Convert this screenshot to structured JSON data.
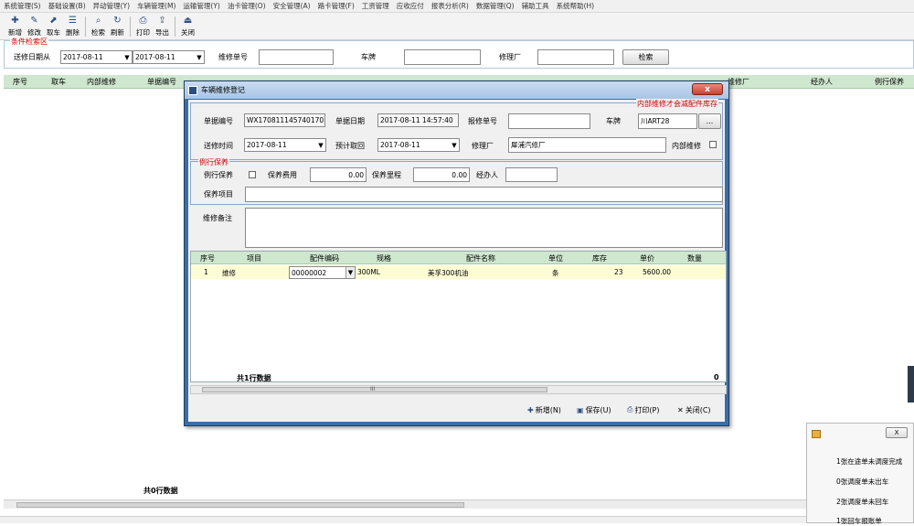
{
  "menu": [
    "系统管理(S)",
    "基础设置(B)",
    "异动管理(Y)",
    "车辆管理(M)",
    "运输管理(Y)",
    "油卡管理(O)",
    "安全管理(A)",
    "路卡管理(F)",
    "工资管理",
    "应收应付",
    "报表分析(R)",
    "数据管理(Q)",
    "辅助工具",
    "系统帮助(H)"
  ],
  "toolbar": {
    "new": "新增",
    "edit": "修改",
    "pick": "取车",
    "delete": "删除",
    "search": "检索",
    "refresh": "刷新",
    "print": "打印",
    "export": "导出",
    "close": "关闭"
  },
  "condition": {
    "legend": "条件检索区",
    "date_label": "送修日期从",
    "date_from": "2017-08-11",
    "date_to": "2017-08-11",
    "repair_no_label": "维修单号",
    "plate_label": "车牌",
    "factory_label": "修理厂",
    "search_btn": "检索"
  },
  "main_table": {
    "headers": [
      "序号",
      "取车",
      "内部维修",
      "单据编号",
      "维修厂",
      "经办人",
      "例行保养"
    ],
    "footer": "共0行数据"
  },
  "dialog": {
    "title": "车辆维修登记",
    "close_glyph": "x",
    "doc_no_label": "单据编号",
    "doc_no": "WX170811145740170",
    "doc_date_label": "单据日期",
    "doc_date": "2017-08-11 14:57:40",
    "report_no_label": "报修单号",
    "report_no": "",
    "plate_label": "车牌",
    "plate": "川ART28",
    "plate_btn": "...",
    "internal_note": "内部维修才会减配件库存",
    "send_time_label": "送修时间",
    "send_time": "2017-08-11",
    "expected_label": "预计取回",
    "expected": "2017-08-11",
    "factory_label": "修理厂",
    "factory": "犀浦汽修厂",
    "internal_label": "内部维修",
    "maintenance": {
      "legend": "例行保养",
      "routine_label": "例行保养",
      "fee_label": "保养费用",
      "fee": "0.00",
      "mileage_label": "保养里程",
      "mileage": "0.00",
      "handler_label": "经办人",
      "handler": "",
      "items_label": "保养项目"
    },
    "remarks_label": "维修备注",
    "grid": {
      "headers": [
        "序号",
        "项目",
        "配件编码",
        "规格",
        "配件名称",
        "单位",
        "库存",
        "单价",
        "数量"
      ],
      "rows": [
        {
          "no": "1",
          "item": "维修",
          "code": "00000002",
          "spec": "300ML",
          "name": "美孚300机油",
          "unit": "条",
          "stock": "23",
          "price": "5600.00",
          "qty": ""
        }
      ],
      "footer": "共1行数据",
      "footer_total": "0",
      "scroll_glyph": "III"
    },
    "buttons": {
      "new": "新增(N)",
      "save": "保存(U)",
      "print": "打印(P)",
      "close": "关闭(C)"
    }
  },
  "notification": {
    "close_glyph": "X",
    "lines": [
      "1张在途单未调度完成",
      "0张调度单未出车",
      "2张调度单未回车",
      "1张回车报账单"
    ]
  }
}
